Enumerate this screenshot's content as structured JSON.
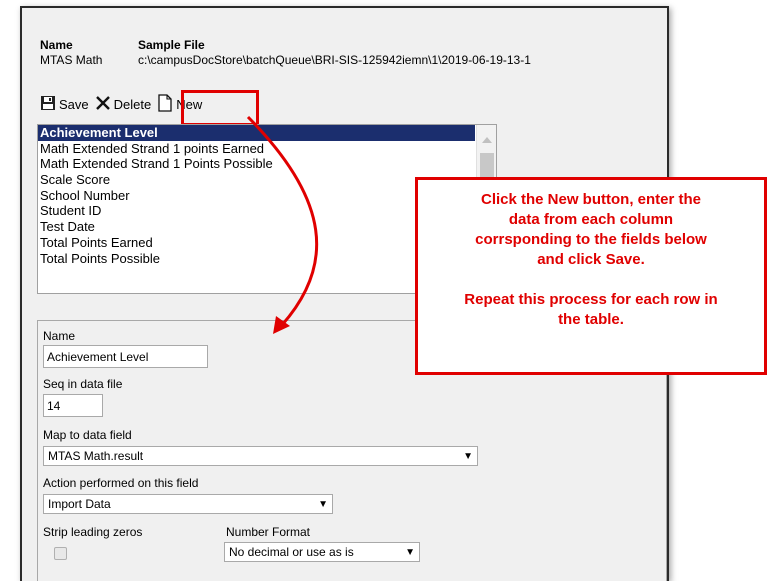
{
  "header": {
    "name_label": "Name",
    "file_label": "Sample File",
    "name_value": "MTAS Math",
    "file_value": "c:\\campusDocStore\\batchQueue\\BRI-SIS-125942iemn\\1\\2019-06-19-13-1"
  },
  "toolbar": {
    "save_label": "Save",
    "delete_label": "Delete",
    "new_label": "New",
    "save_icon": "floppy-disk-icon",
    "delete_icon": "x-icon",
    "new_icon": "blank-page-icon"
  },
  "list": {
    "items": [
      "Achievement Level",
      "Math Extended Strand 1 points Earned",
      "Math Extended Strand 1 Points Possible",
      "Scale Score",
      "School Number",
      "Student ID",
      "Test Date",
      "Total Points Earned",
      "Total Points Possible"
    ],
    "selected": "Achievement Level"
  },
  "form": {
    "name_label": "Name",
    "name_value": "Achievement Level",
    "seq_label": "Seq in data file",
    "seq_value": "14",
    "map_label": "Map to data field",
    "map_value": "MTAS Math.result",
    "action_label": "Action performed on this field",
    "action_value": "Import Data",
    "strip_label": "Strip leading zeros",
    "number_format_label": "Number Format",
    "number_format_value": "No decimal or use as is"
  },
  "callout": {
    "line1": "Click the New button, enter the",
    "line2": "data from each column",
    "line3": "corrsponding to the fields below",
    "line4": "and click Save.",
    "line5": "Repeat this process for each row in",
    "line6": "the table.",
    "color": "#e00000"
  },
  "colors": {
    "selection": "#1b2e6e",
    "annotation": "#e00000",
    "panel": "#f0f0f0"
  }
}
